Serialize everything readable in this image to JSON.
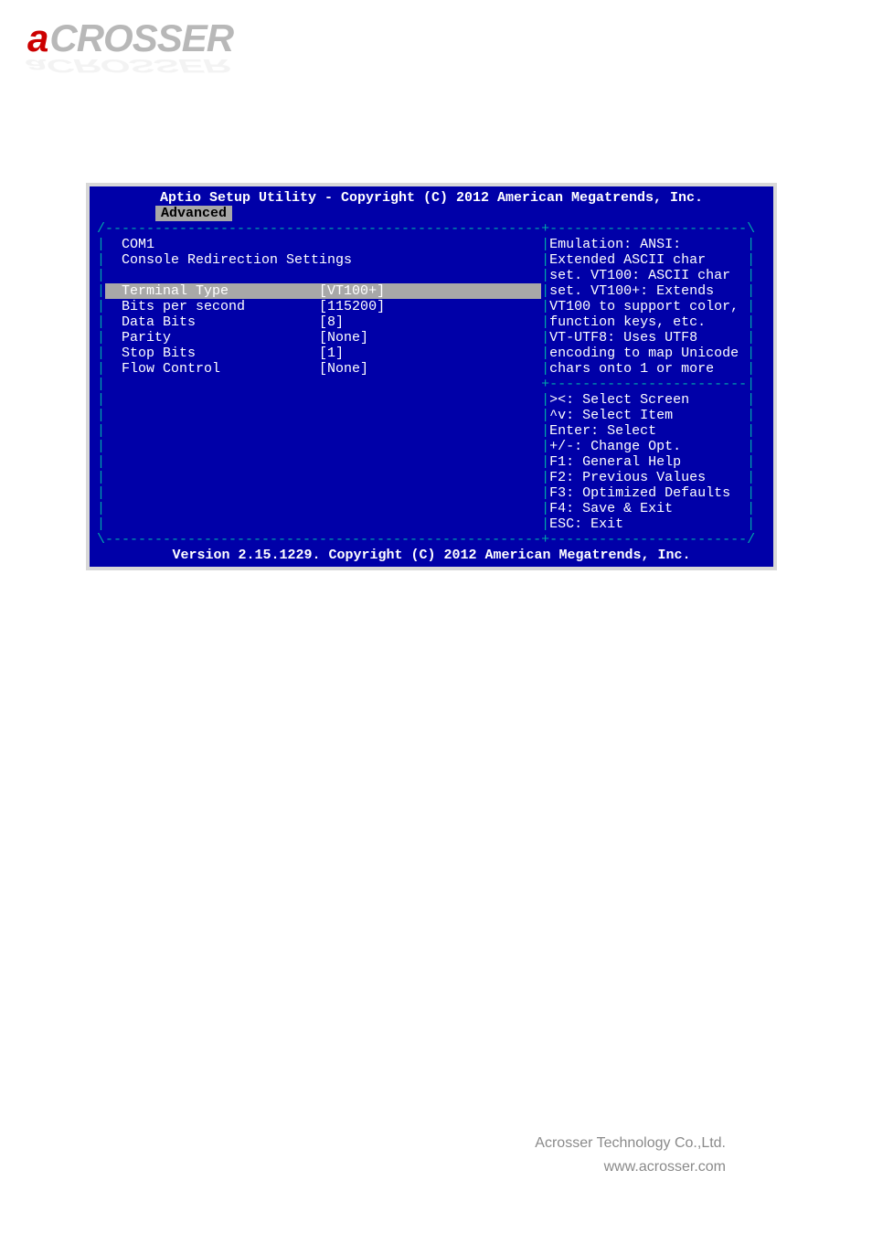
{
  "logo": {
    "first": "a",
    "rest": "CROSSER"
  },
  "bios": {
    "header": "Aptio Setup Utility - Copyright (C) 2012 American Megatrends, Inc.",
    "tab": "Advanced",
    "section_title": "COM1",
    "section_subtitle": "Console Redirection Settings",
    "settings": [
      {
        "label": "Terminal Type",
        "value": "[VT100+]"
      },
      {
        "label": "Bits per second",
        "value": "[115200]"
      },
      {
        "label": "Data Bits",
        "value": "[8]"
      },
      {
        "label": "Parity",
        "value": "[None]"
      },
      {
        "label": "Stop Bits",
        "value": "[1]"
      },
      {
        "label": "Flow Control",
        "value": "[None]"
      }
    ],
    "help_lines": [
      "Emulation: ANSI:",
      "Extended ASCII char",
      "set. VT100: ASCII char",
      "set. VT100+: Extends",
      "VT100 to support color,",
      "function keys, etc.",
      "VT-UTF8: Uses UTF8",
      "encoding to map Unicode",
      "chars onto 1 or more"
    ],
    "keyhelp": [
      "><: Select Screen",
      "^v: Select Item",
      "Enter: Select",
      "+/-: Change Opt.",
      "F1: General Help",
      "F2: Previous Values",
      "F3: Optimized Defaults",
      "F4: Save & Exit",
      "ESC: Exit"
    ],
    "footer": "Version 2.15.1229. Copyright (C) 2012 American Megatrends, Inc."
  },
  "page_footer": {
    "company": "Acrosser Technology Co.,Ltd.",
    "url": "www.acrosser.com"
  }
}
